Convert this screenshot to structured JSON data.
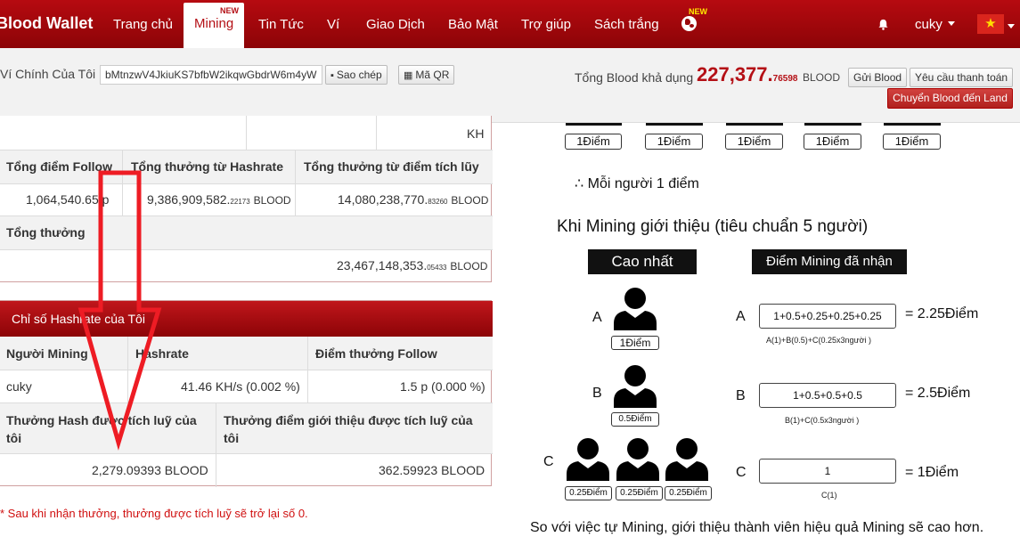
{
  "navbar": {
    "brand": "Blood Wallet",
    "items": [
      {
        "label": "Trang chủ"
      },
      {
        "label": "Mining",
        "badge": "NEW"
      },
      {
        "label": "Tin Tức"
      },
      {
        "label": "Ví"
      },
      {
        "label": "Giao Dịch"
      },
      {
        "label": "Bảo Mật"
      },
      {
        "label": "Trợ giúp"
      },
      {
        "label": "Sách trắng"
      }
    ],
    "globe_badge": "NEW",
    "user": "cuky",
    "flag_glyph": "★"
  },
  "wallet": {
    "label": "Ví Chính Của Tôi",
    "address": "bMtnzwV4JkiuKS7bfbW2ikqwGbdrW6m4yW",
    "copy_label": "Sao chép",
    "qr_label": "Mã QR",
    "total_label": "Tổng Blood khả dụng",
    "total_main": "227,377.",
    "total_decimal": "76598",
    "total_unit": "BLOOD",
    "send_label": "Gửi Blood",
    "request_label": "Yêu cầu thanh toán",
    "transfer_label": "Chuyển Blood đến Land"
  },
  "summary_table": {
    "top_cell": "KH",
    "headers": [
      "Tổng điểm Follow",
      "Tổng thưởng từ Hashrate",
      "Tổng thưởng từ điểm tích lũy"
    ],
    "follow_value": "1,064,540.65",
    "follow_unit": "p",
    "hashrate_main": "9,386,909,582.",
    "hashrate_dec": "22173",
    "accum_main": "14,080,238,770.",
    "accum_dec": "83260",
    "unit": "BLOOD",
    "total_label": "Tổng thưởng",
    "total_main": "23,467,148,353.",
    "total_dec": "05433"
  },
  "hashrate_table": {
    "title": "Chỉ số Hashrate của Tôi",
    "headers": [
      "Người Mining",
      "Hashrate",
      "Điểm thưởng Follow"
    ],
    "miner": "cuky",
    "hashrate_value": "41.46 KH/s (0.002 %)",
    "follow_value": "1.5 p (0.000 %)",
    "accum_hash_label": "Thưởng Hash được tích luỹ của tôi",
    "accum_ref_label": "Thưởng điểm giới thiệu được tích luỹ của tôi",
    "accum_hash_value": "2,279.09393 BLOOD",
    "accum_ref_value": "362.59923 BLOOD"
  },
  "note": "* Sau khi nhận thưởng, thưởng được tích luỹ sẽ trở lại số 0.",
  "diagram": {
    "top_points": [
      "1Điểm",
      "1Điểm",
      "1Điểm",
      "1Điểm",
      "1Điểm"
    ],
    "each_line": "∴ Mỗi người 1 điểm",
    "title": "Khi Mining giới thiệu (tiêu chuẩn 5 người)",
    "col_left": "Cao nhất",
    "col_right": "Điểm Mining đã nhận",
    "rows": [
      {
        "letter": "A",
        "point": "1Điểm",
        "formula": "1+0.5+0.25+0.25+0.25",
        "sub": "A(1)+B(0.5)+C(0.25x3người )",
        "result": "= 2.25Điểm"
      },
      {
        "letter": "B",
        "point": "0.5Điểm",
        "formula": "1+0.5+0.5+0.5",
        "sub": "B(1)+C(0.5x3người )",
        "result": "= 2.5Điểm"
      },
      {
        "letter": "C",
        "point": "0.25Điểm",
        "formula": "1",
        "sub": "C(1)",
        "result": "= 1Điểm"
      }
    ],
    "footer": "So với việc tự Mining, giới thiệu thành viên hiệu quả Mining sẽ cao hơn."
  },
  "colors": {
    "brand": "#b41016",
    "annotation": "#ee1c24"
  }
}
